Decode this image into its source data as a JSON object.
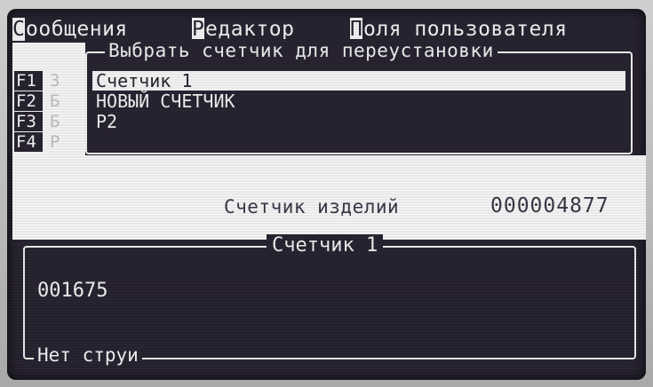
{
  "menu": {
    "items": [
      {
        "hotkey": "С",
        "rest": "ообщения"
      },
      {
        "hotkey": "Р",
        "rest": "едактор"
      },
      {
        "hotkey": "П",
        "rest": "оля пользователя"
      }
    ]
  },
  "function_keys": [
    {
      "key": "F1",
      "letter": "З"
    },
    {
      "key": "F2",
      "letter": "Б"
    },
    {
      "key": "F3",
      "letter": "Б"
    },
    {
      "key": "F4",
      "letter": "Р"
    }
  ],
  "counter_list": {
    "title": "Выбрать счетчик для переустановки",
    "items": [
      "Счетчик 1",
      "НОВЫЙ СЧЕТЧИК",
      "Р2"
    ],
    "selected_index": 0
  },
  "info": {
    "product_counter_label": "Счетчик изделий",
    "product_counter_value": "000004877"
  },
  "counter_panel": {
    "title": "Счетчик 1",
    "value": "001675",
    "status": "Нет струи"
  },
  "colors": {
    "screen_background": "#272230",
    "foreground": "#f2f2f2"
  }
}
